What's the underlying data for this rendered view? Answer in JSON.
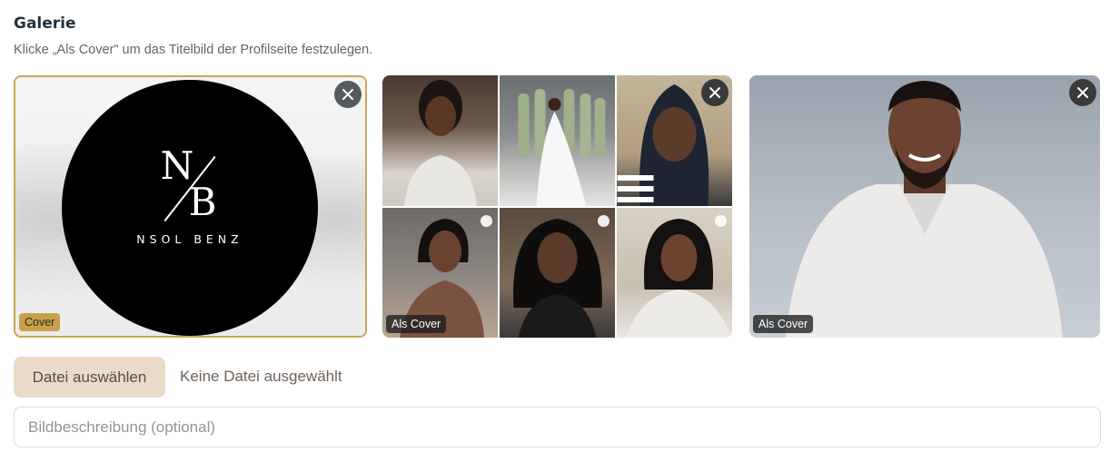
{
  "gallery": {
    "title": "Galerie",
    "subtitle": "Klicke „Als Cover\" um das Titelbild der Profilseite festzulegen.",
    "items": [
      {
        "badge": "Cover",
        "logo_top": "N",
        "logo_bottom": "B",
        "brand": "NSOL BENZ"
      },
      {
        "badge": "Als Cover"
      },
      {
        "badge": "Als Cover"
      }
    ]
  },
  "upload": {
    "button_label": "Datei auswählen",
    "status": "Keine Datei ausgewählt"
  },
  "description": {
    "placeholder": "Bildbeschreibung (optional)"
  },
  "colors": {
    "accent_gold": "#c9a04a",
    "button_bg": "#eadbc9",
    "title_color": "#22313f"
  }
}
